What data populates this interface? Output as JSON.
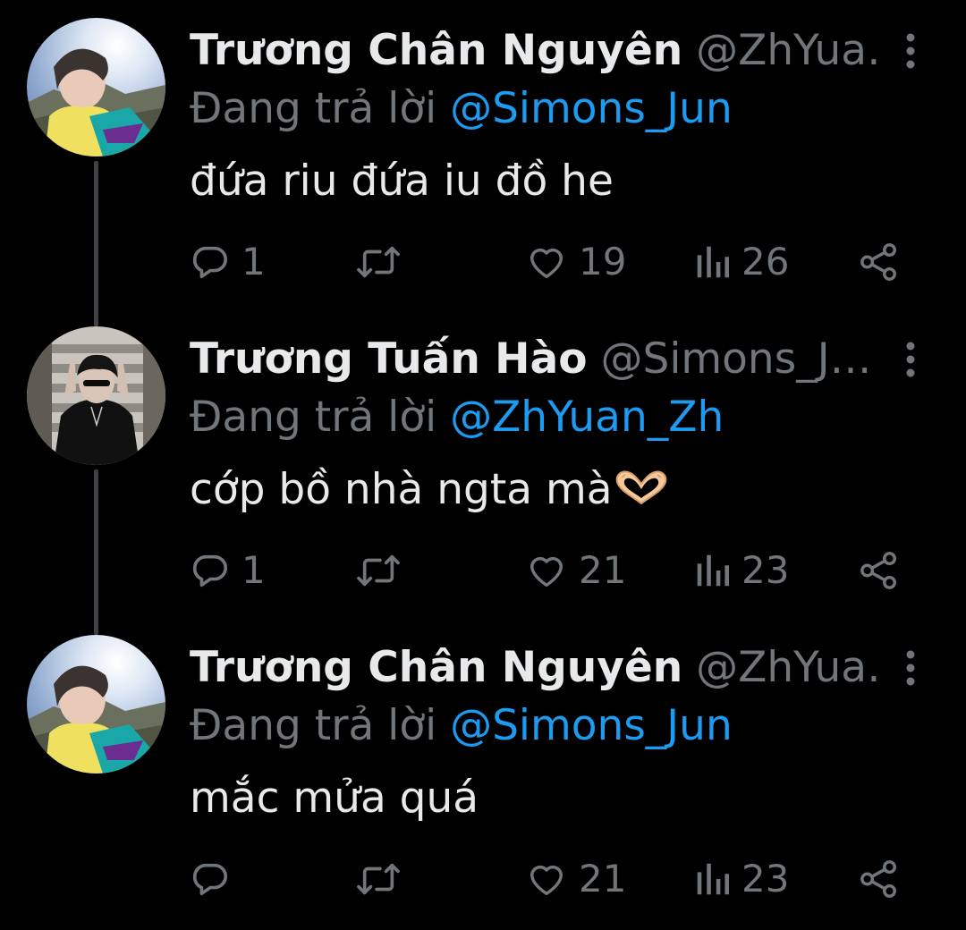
{
  "thread": {
    "tweets": [
      {
        "author": {
          "name": "Trương Chân Nguyên",
          "handle": "@ZhYua…"
        },
        "reply_prefix": "Đang trả lời ",
        "reply_to": "@Simons_Jun",
        "text": "đứa riu đứa iu đồ he",
        "stats": {
          "replies": "1",
          "retweets": "",
          "likes": "19",
          "views": "26"
        },
        "icons": [
          "reply-icon",
          "retweet-icon",
          "like-icon",
          "views-icon",
          "share-icon"
        ]
      },
      {
        "author": {
          "name": "Trương Tuấn Hào",
          "handle": "@Simons_J…"
        },
        "reply_prefix": "Đang trả lời ",
        "reply_to": "@ZhYuan_Zh",
        "text": "cớp bồ nhà ngta mà",
        "text_emoji": "heart-hands-emoji",
        "stats": {
          "replies": "1",
          "retweets": "",
          "likes": "21",
          "views": "23"
        },
        "icons": [
          "reply-icon",
          "retweet-icon",
          "like-icon",
          "views-icon",
          "share-icon"
        ]
      },
      {
        "author": {
          "name": "Trương Chân Nguyên",
          "handle": "@ZhYua…"
        },
        "reply_prefix": "Đang trả lời ",
        "reply_to": "@Simons_Jun",
        "text": "mắc mửa quá",
        "stats": {
          "replies": "",
          "retweets": "",
          "likes": "21",
          "views": "23"
        },
        "icons": [
          "reply-icon",
          "retweet-icon",
          "like-icon",
          "views-icon",
          "share-icon"
        ]
      }
    ]
  },
  "colors": {
    "background": "#000000",
    "text_primary": "#e7e9ea",
    "text_secondary": "#71767b",
    "mention": "#1d9bf0",
    "connector": "#3e4144"
  }
}
